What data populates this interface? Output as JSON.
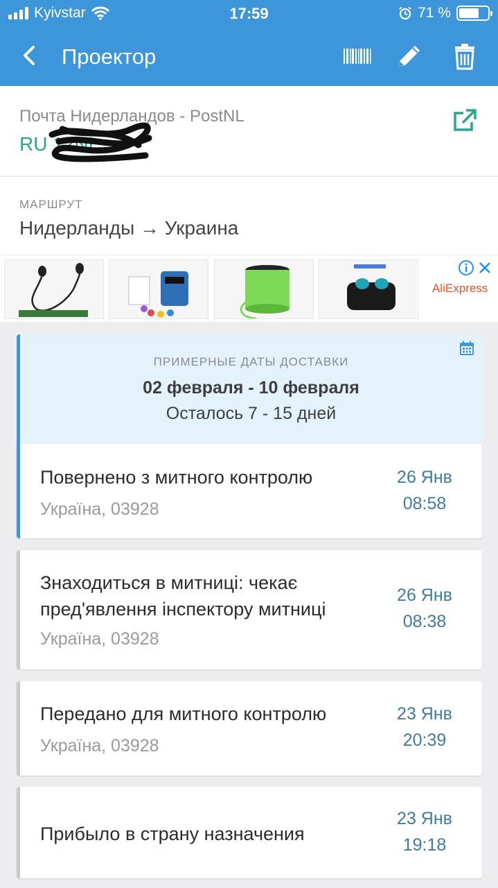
{
  "status_bar": {
    "carrier": "Kyivstar",
    "time": "17:59",
    "battery": "71 %",
    "battery_level": 0.71
  },
  "nav": {
    "title": "Проектор",
    "back_icon": "chevron-left-icon",
    "barcode_icon": "barcode-icon",
    "edit_icon": "pencil-icon",
    "delete_icon": "trash-icon"
  },
  "carrier": {
    "name": "Почта Нидерландов - PostNL",
    "tracking_visible": "RU         12NL",
    "tracking_color": "#25a88e"
  },
  "route": {
    "label": "МАРШРУТ",
    "value": "Нидерланды → Украина"
  },
  "ad": {
    "brand": "AliExpress",
    "info_icon": "info-icon",
    "close_icon": "close-icon"
  },
  "delivery": {
    "label": "ПРИМЕРНЫЕ ДАТЫ ДОСТАВКИ",
    "dates": "02 февраля - 10 февраля",
    "remaining": "Осталось 7 - 15 дней"
  },
  "events": [
    {
      "title": "Повернено з митного контролю",
      "location": "Україна, 03928",
      "date": "26 Янв",
      "time": "08:58"
    },
    {
      "title": "Знаходиться в митниці: чекає пред'явлення інспектору митниці",
      "location": "Україна, 03928",
      "date": "26 Янв",
      "time": "08:38"
    },
    {
      "title": "Передано для митного контролю",
      "location": "Україна, 03928",
      "date": "23 Янв",
      "time": "20:39"
    },
    {
      "title": "Прибыло в страну назначения",
      "location": "",
      "date": "23 Янв",
      "time": "19:18"
    }
  ],
  "colors": {
    "header": "#3d96d9",
    "accent_green": "#25a88e",
    "date_blue": "#3e7aa5",
    "delivery_bg": "#e4f2fc"
  }
}
